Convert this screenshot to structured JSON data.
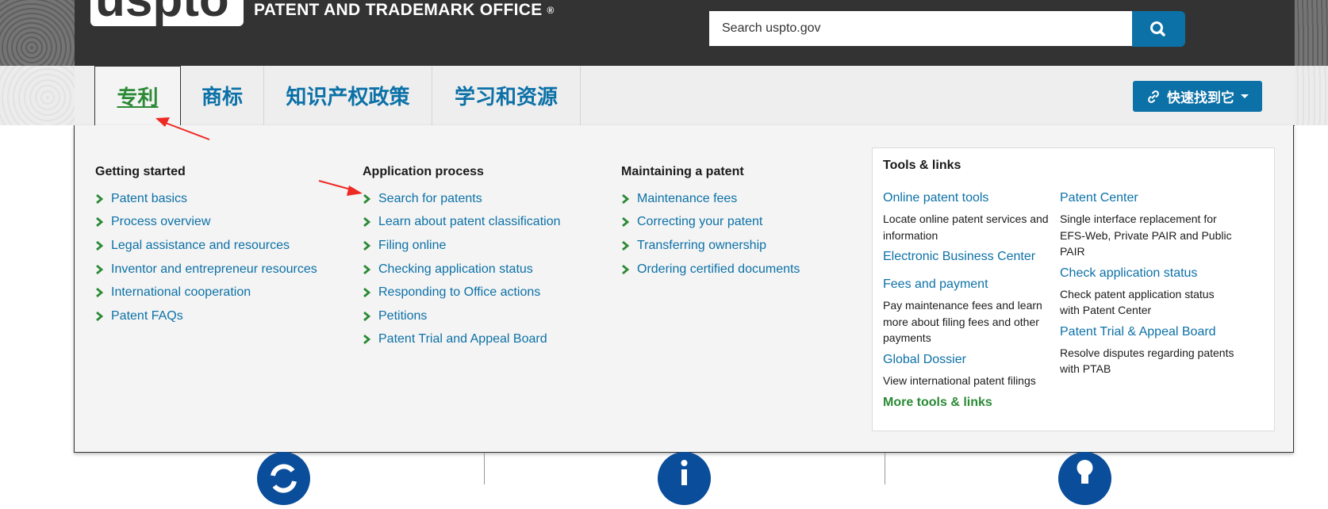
{
  "header": {
    "logo_text": "uspto",
    "office_name": "PATENT AND TRADEMARK OFFICE",
    "office_reg": "®",
    "search_placeholder": "Search uspto.gov",
    "search_icon": "search-icon",
    "brand_color": "#0c71a7"
  },
  "nav": {
    "tabs": [
      {
        "label": "专利",
        "active": true
      },
      {
        "label": "商标"
      },
      {
        "label": "知识产权政策"
      },
      {
        "label": "学习和资源"
      }
    ],
    "quick_find_label": "快速找到它",
    "quick_find_icon": "link-icon"
  },
  "mega": {
    "columns": [
      {
        "title": "Getting started",
        "links": [
          "Patent basics",
          "Process overview",
          "Legal assistance and resources",
          "Inventor and entrepreneur resources",
          "International cooperation",
          "Patent FAQs"
        ]
      },
      {
        "title": "Application process",
        "links": [
          "Search for patents",
          "Learn about patent classification",
          "Filing online",
          "Checking application status",
          "Responding to Office actions",
          "Petitions",
          "Patent Trial and Appeal Board"
        ]
      },
      {
        "title": "Maintaining a patent",
        "links": [
          "Maintenance fees",
          "Correcting your patent",
          "Transferring ownership",
          "Ordering certified documents"
        ]
      }
    ],
    "tools": {
      "title": "Tools & links",
      "left": [
        {
          "link": "Online patent tools",
          "desc": "Locate online patent services and information"
        },
        {
          "link": "Electronic Business Center",
          "desc": ""
        },
        {
          "link": "Fees and payment",
          "desc": "Pay maintenance fees and learn more about filing fees and other payments"
        },
        {
          "link": "Global Dossier",
          "desc": "View international patent filings"
        }
      ],
      "right": [
        {
          "link": "Patent Center",
          "desc": "Single interface replacement for EFS-Web, Private PAIR and Public PAIR"
        },
        {
          "link": "Check application status",
          "desc": "Check patent application status with Patent Center"
        },
        {
          "link": "Patent Trial & Appeal Board",
          "desc": "Resolve disputes regarding patents with PTAB"
        }
      ],
      "more_label": "More tools & links"
    }
  },
  "bottom_icons": [
    "refresh-icon",
    "info-icon",
    "lightbulb-icon"
  ],
  "accent_green": "#2b8a36",
  "arrow_color": "#ee2a24"
}
